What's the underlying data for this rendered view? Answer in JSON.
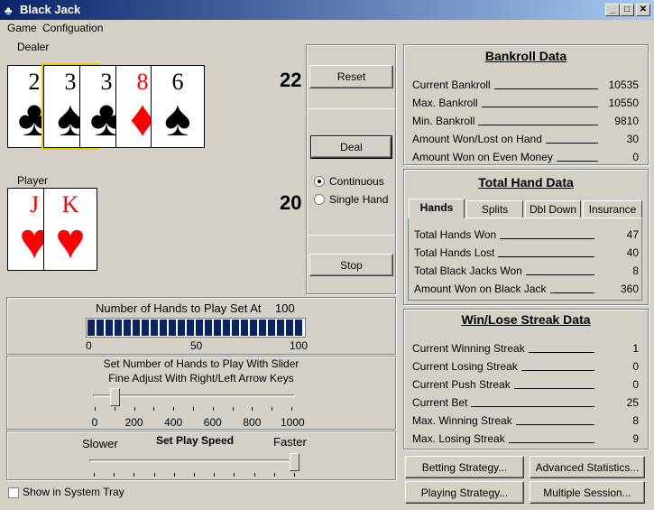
{
  "window": {
    "title": "Black Jack",
    "min": "_",
    "max": "□",
    "close": "✕"
  },
  "menu": {
    "game": "Game",
    "config": "Configuation"
  },
  "dealer": {
    "label": "Dealer",
    "score": "22",
    "cards": [
      {
        "rank": "2",
        "suit": "♣"
      },
      {
        "rank": "3",
        "suit": "♠"
      },
      {
        "rank": "3",
        "suit": "♣"
      },
      {
        "rank": "8",
        "suit": "♦"
      },
      {
        "rank": "6",
        "suit": "♠"
      }
    ]
  },
  "player": {
    "label": "Player",
    "score": "20",
    "cards": [
      {
        "rank": "J",
        "suit": "♥"
      },
      {
        "rank": "K",
        "suit": "♥"
      }
    ]
  },
  "controls": {
    "reset": "Reset",
    "deal": "Deal",
    "continuous": "Continuous",
    "single_hand": "Single Hand",
    "stop": "Stop",
    "mode_selected": "continuous"
  },
  "hands_panel": {
    "label": "Number of Hands to Play Set At",
    "value": "100",
    "progress_fraction": 1.0,
    "scale": [
      "0",
      "50",
      "100"
    ]
  },
  "slider_panel": {
    "line1": "Set Number of Hands to Play With Slider",
    "line2": "Fine Adjust With Right/Left Arrow Keys",
    "scale": [
      "0",
      "200",
      "400",
      "600",
      "800",
      "1000"
    ],
    "value": 100
  },
  "speed_panel": {
    "title": "Set Play Speed",
    "slower": "Slower",
    "faster": "Faster",
    "value_fraction": 1.0
  },
  "tray": {
    "label": "Show in System Tray"
  },
  "bankroll": {
    "title": "Bankroll Data",
    "rows": [
      {
        "label": "Current Bankroll",
        "value": "10535"
      },
      {
        "label": "Max. Bankroll",
        "value": "10550"
      },
      {
        "label": "Min. Bankroll",
        "value": "9810"
      },
      {
        "label": "Amount Won/Lost on Hand",
        "value": "30"
      },
      {
        "label": "Amount Won on Even Money",
        "value": "0"
      }
    ]
  },
  "hand_data": {
    "title": "Total Hand Data",
    "tabs": [
      "Hands",
      "Splits",
      "Dbl Down",
      "Insurance"
    ],
    "rows": [
      {
        "label": "Total Hands Won",
        "value": "47"
      },
      {
        "label": "Total Hands Lost",
        "value": "40"
      },
      {
        "label": "Total Black Jacks Won",
        "value": "8"
      },
      {
        "label": "Amount Won on Black Jack",
        "value": "360"
      }
    ]
  },
  "streak": {
    "title": "Win/Lose Streak Data",
    "rows": [
      {
        "label": "Current Winning Streak",
        "value": "1"
      },
      {
        "label": "Current Losing Streak",
        "value": "0"
      },
      {
        "label": "Current Push Streak",
        "value": "0"
      },
      {
        "label": "Current Bet",
        "value": "25"
      },
      {
        "label": "Max. Winning Streak",
        "value": "8"
      },
      {
        "label": "Max. Losing Streak",
        "value": "9"
      }
    ]
  },
  "bottom_buttons": {
    "betting": "Betting Strategy...",
    "advanced": "Advanced Statistics...",
    "playing": "Playing Strategy...",
    "multiple": "Multiple Session..."
  }
}
